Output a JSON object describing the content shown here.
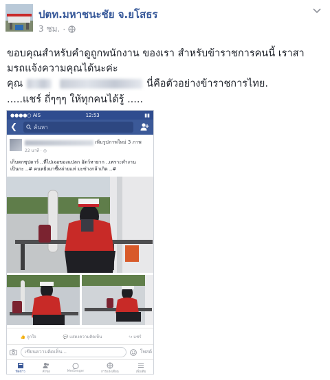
{
  "post": {
    "page_name": "ปตท.มหาชนะชัย จ.ยโสธร",
    "time": "3 ชม.",
    "dot": "·",
    "line1": "ขอบคุณสำหรับคำดูถูกพนักงาน ของเรา สำหรับข้าราชการคนนี้ เราสา",
    "line2": "มรถแจ้งความคุณได้นะค่ะ",
    "line3_prefix": "คุณ",
    "line3_suffix": "นี่คือตัวอย่างข้าราชการไทย.",
    "line4": ".....แชร์ ถี่ๆๆๆ ให้ทุกคนได้รู้ ....."
  },
  "phone": {
    "carrier": "●●●●○ AIS",
    "clock": "12:53",
    "battery": "▮▮",
    "search_placeholder": "ค้นหา",
    "post_title": "เพิ่มรูปภาพใหม่ 3 ภาพ",
    "post_time": "22 นาที · ◎",
    "caption1": "เก็บตกซุปตาร์ ..ที่ไปเจอของแปลก อัตว์หายาก ..เพราะทำงาน",
    "caption2": "เป็นกะ ..# คนหยิ่งมาซี้หล่ายแห่ มะซ่างกล้าเกิด ..#",
    "like": "ถูกใจ",
    "comment": "แสดงความคิดเห็น",
    "share": "แชร์",
    "comment_placeholder": "เขียนความคิดเห็น...",
    "post_button": "โพสต์",
    "tabs": [
      "ฟีดข่าว",
      "คำขอ",
      "Messenger",
      "การแจ้งเตือน",
      "เพิ่มเติม"
    ]
  }
}
